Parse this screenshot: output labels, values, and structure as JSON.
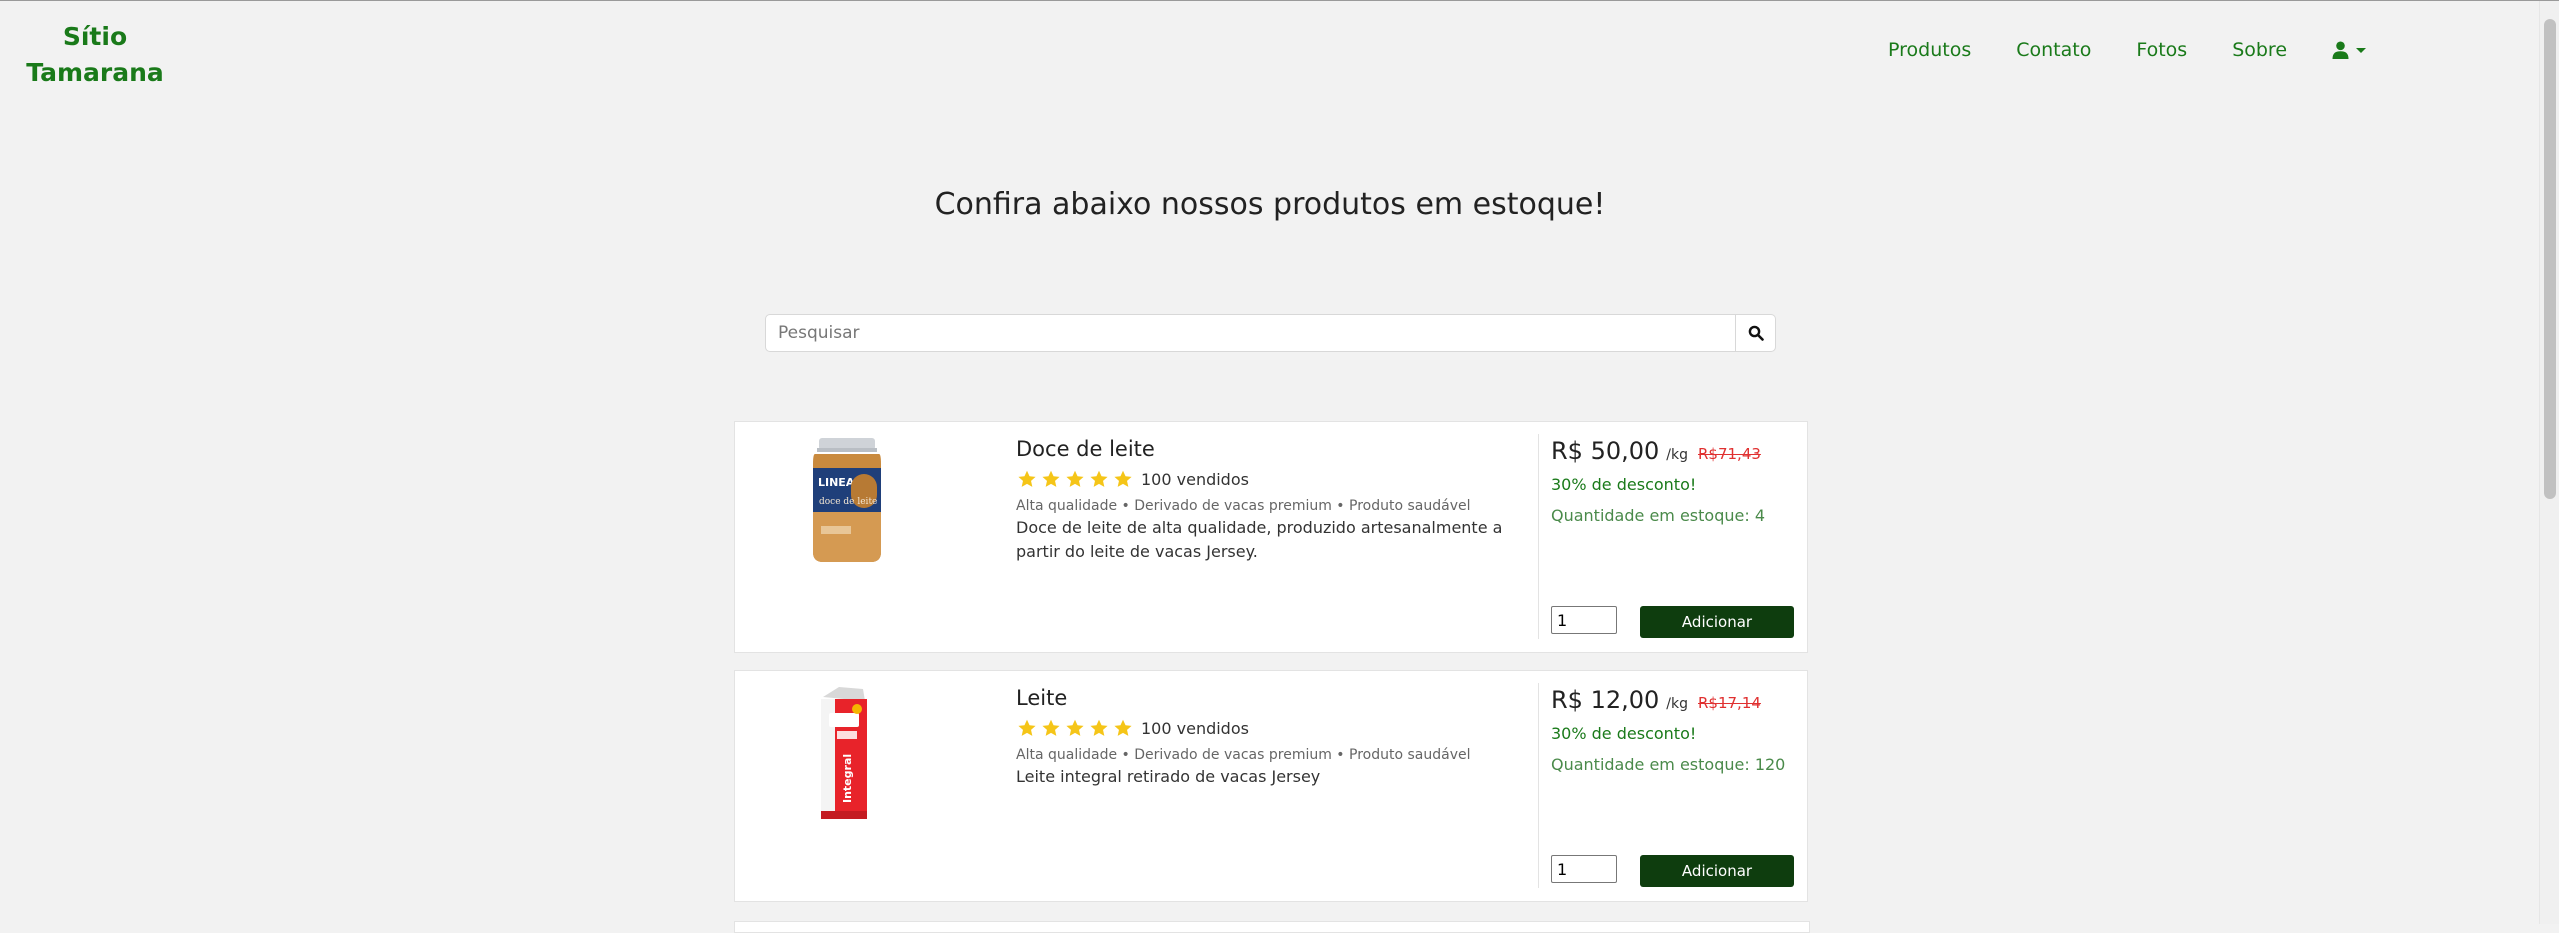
{
  "brand": {
    "line1": "Sítio",
    "line2": "Tamarana"
  },
  "nav": {
    "items": [
      "Produtos",
      "Contato",
      "Fotos",
      "Sobre"
    ]
  },
  "headline": "Confira abaixo nossos produtos em estoque!",
  "search": {
    "placeholder": "Pesquisar",
    "value": ""
  },
  "products": [
    {
      "name": "Doce de leite",
      "rating": 5,
      "sold": "100 vendidos",
      "tags": "Alta qualidade • Derivado de vacas premium • Produto saudável",
      "description": "Doce de leite de alta qualidade, produzido artesanalmente a partir do leite de vacas Jersey.",
      "price": "R$ 50,00",
      "unit": "/kg",
      "old_price": "R$71,43",
      "discount": "30% de desconto!",
      "stock": "Quantidade em estoque: 4",
      "quantity": "1",
      "add_label": "Adicionar"
    },
    {
      "name": "Leite",
      "rating": 5,
      "sold": "100 vendidos",
      "tags": "Alta qualidade • Derivado de vacas premium • Produto saudável",
      "description": "Leite integral retirado de vacas Jersey",
      "price": "R$ 12,00",
      "unit": "/kg",
      "old_price": "R$17,14",
      "discount": "30% de desconto!",
      "stock": "Quantidade em estoque: 120",
      "quantity": "1",
      "add_label": "Adicionar"
    }
  ],
  "colors": {
    "brand": "#1a7a1a",
    "button": "#0e3d0e",
    "old_price": "#e03030",
    "star": "#f5c518"
  },
  "icons": {
    "user": "user-icon",
    "search": "search-icon",
    "star": "star-icon"
  }
}
